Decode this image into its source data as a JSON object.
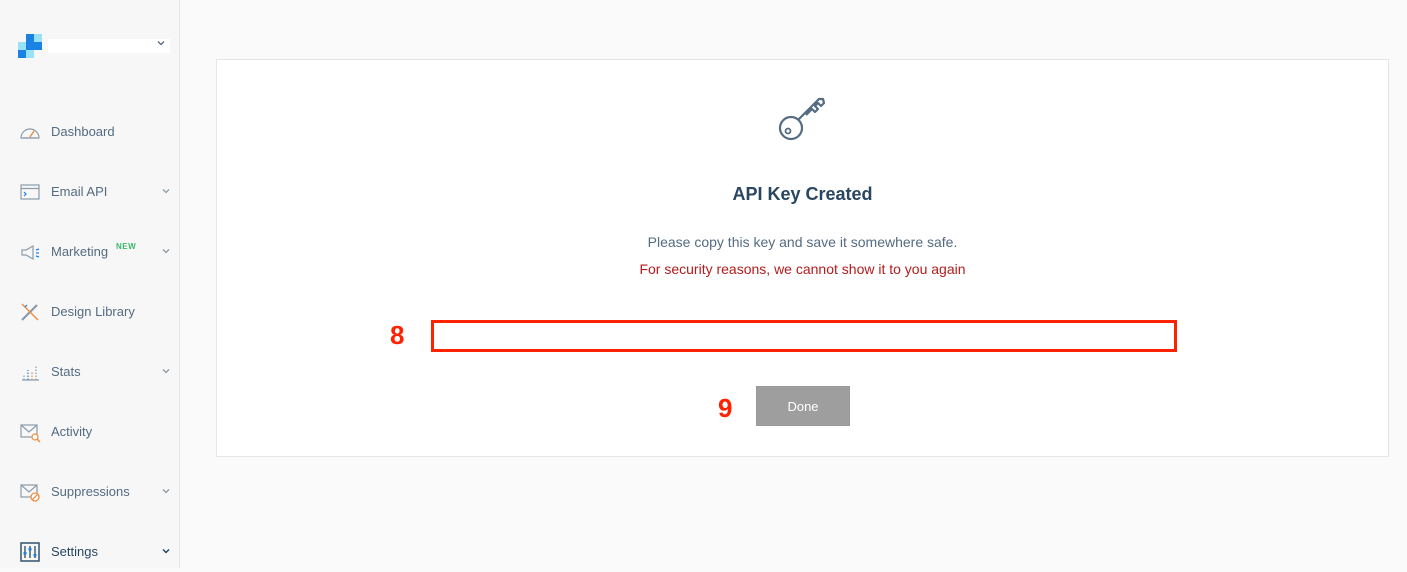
{
  "sidebar": {
    "account_name": "",
    "items": [
      {
        "label": "Dashboard",
        "icon": "gauge-icon"
      },
      {
        "label": "Email API",
        "icon": "terminal-icon"
      },
      {
        "label": "Marketing",
        "icon": "megaphone-icon",
        "badge": "NEW"
      },
      {
        "label": "Design Library",
        "icon": "design-tools-icon"
      },
      {
        "label": "Stats",
        "icon": "bar-chart-icon"
      },
      {
        "label": "Activity",
        "icon": "mail-search-icon"
      },
      {
        "label": "Suppressions",
        "icon": "mail-block-icon"
      },
      {
        "label": "Settings",
        "icon": "sliders-icon"
      }
    ]
  },
  "dialog": {
    "icon": "key-icon",
    "title": "API Key Created",
    "message": "Please copy this key and save it somewhere safe.",
    "warning": "For security reasons, we cannot show it to you again",
    "api_key_value": "",
    "done_label": "Done"
  },
  "annotations": {
    "key_field_marker": "8",
    "done_marker": "9"
  },
  "colors": {
    "accent_navy": "#294661",
    "text_muted": "#546b81",
    "warning_red": "#b31c1c",
    "badge_green": "#3bb86a",
    "annotation_red": "#ff2200",
    "logo_blue": "#1a82e2",
    "button_gray": "#9e9e9e"
  }
}
